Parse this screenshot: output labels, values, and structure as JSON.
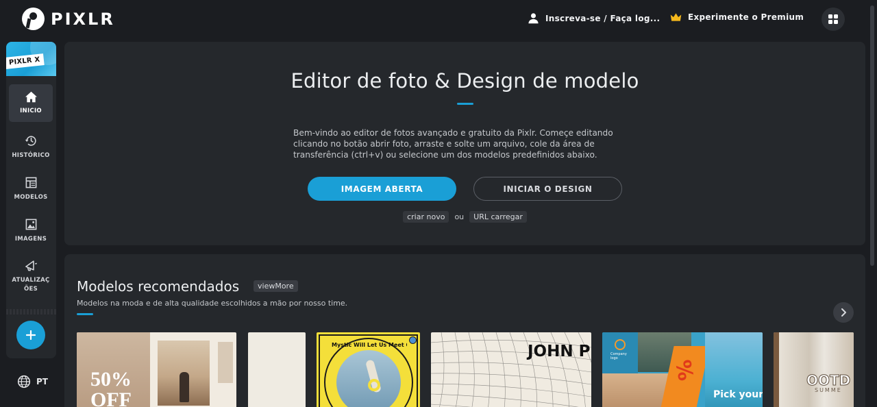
{
  "header": {
    "brand": "PIXLR",
    "login_label": "Inscreva-se / Faça log...",
    "premium_label": "Experimente o Premium"
  },
  "sidebar": {
    "pixlrx_label": "PIXLR X",
    "items": [
      {
        "label": "INICIO",
        "icon": "home-icon",
        "active": true
      },
      {
        "label": "HISTÓRICO",
        "icon": "history-icon",
        "active": false
      },
      {
        "label": "MODELOS",
        "icon": "templates-icon",
        "active": false
      },
      {
        "label": "IMAGENS",
        "icon": "images-icon",
        "active": false
      },
      {
        "label": "ATUALIZAÇÕES",
        "icon": "megaphone-icon",
        "active": false
      }
    ],
    "language": "PT"
  },
  "hero": {
    "title": "Editor de foto & Design de modelo",
    "description": "Bem-vindo ao editor de fotos avançado e gratuito da Pixlr. Começe editando clicando no botão abrir foto, arraste e solte um arquivo, cole da área de transferência (ctrl+v) ou selecione um dos modelos predefinidos abaixo.",
    "open_image_label": "IMAGEM ABERTA",
    "start_design_label": "INICIAR O DESIGN",
    "create_new_label": "criar novo",
    "or_label": "ou",
    "load_url_label": "URL carregar"
  },
  "templates": {
    "heading": "Modelos recomendados",
    "view_more_label": "viewMore",
    "subheading": "Modelos na moda e de alta qualidade escolhidos a mão por nosso time.",
    "cards": [
      {
        "id": "travel-sale",
        "big_text": "50%",
        "big_text_2": "OFF"
      },
      {
        "id": "blank-beige"
      },
      {
        "id": "badge-circle",
        "ring_text": "Mystic Will Let Us Meet Our Fate Soul And Our Heart"
      },
      {
        "id": "grid-poster",
        "big_text": "JOHN P"
      },
      {
        "id": "venice-promo",
        "small_text": "Company logo",
        "big_text": "Pick your"
      },
      {
        "id": "ootd",
        "big_text": "OOTD",
        "small_text": "SUMME"
      }
    ]
  },
  "colors": {
    "accent": "#1a9fd6",
    "background": "#1b1d21",
    "panel": "#25282c",
    "premium_crown": "#f5b81c"
  }
}
